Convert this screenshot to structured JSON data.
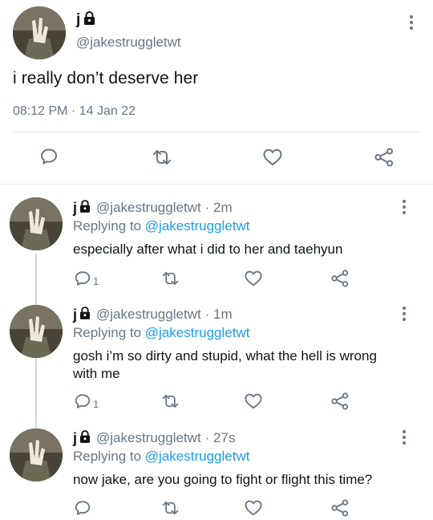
{
  "main_tweet": {
    "display_name": "j",
    "handle": "@jakestruggletwt",
    "text": "i really don’t deserve her",
    "timestamp": "08:12 PM · 14 Jan 22"
  },
  "replies": [
    {
      "display_name": "j",
      "handle": "@jakestruggletwt",
      "time": "· 2m",
      "replying_prefix": "Replying to",
      "replying_to": "@jakestruggletwt",
      "text": "especially after what i did to her and taehyun",
      "reply_count": "1"
    },
    {
      "display_name": "j",
      "handle": "@jakestruggletwt",
      "time": "· 1m",
      "replying_prefix": "Replying to",
      "replying_to": "@jakestruggletwt",
      "text_line1": "gosh i’m so dirty and stupid, what the hell is wrong",
      "text_line2": "with me",
      "reply_count": "1"
    },
    {
      "display_name": "j",
      "handle": "@jakestruggletwt",
      "time": "· 27s",
      "replying_prefix": "Replying to",
      "replying_to": "@jakestruggletwt",
      "text": "now jake, are you going to fight or flight this time?",
      "reply_count": ""
    }
  ],
  "colors": {
    "text": "#0f1419",
    "secondary": "#657786",
    "link": "#1d9bf0",
    "divider": "#e1e8ed",
    "thread_line": "#cfd9de"
  },
  "icons": [
    "lock-icon",
    "more-vertical-icon",
    "reply-icon",
    "retweet-icon",
    "like-icon",
    "share-icon"
  ]
}
